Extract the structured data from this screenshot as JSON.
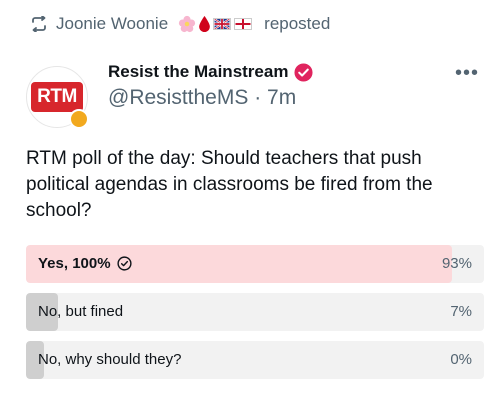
{
  "repost": {
    "user": "Joonie Woonie",
    "label": "reposted",
    "emoji_icons": [
      "cherry-blossom-icon",
      "blood-drop-icon",
      "uk-flag-icon",
      "england-flag-icon"
    ]
  },
  "author": {
    "name": "Resist the Mainstream",
    "handle": "@ResisttheMS",
    "separator": "·",
    "time": "7m",
    "avatar_text": "RTM",
    "verified": true
  },
  "post": {
    "text": "RTM poll of the day: Should teachers that push political agendas in classrooms be fired from the school?"
  },
  "poll": {
    "options": [
      {
        "label": "Yes, 100%",
        "percent_label": "93%",
        "percent": 93,
        "selected": true,
        "fill_color": "#fcd9db"
      },
      {
        "label": "No, but fined",
        "percent_label": "7%",
        "percent": 7,
        "selected": false,
        "fill_color": "#cfcfcf"
      },
      {
        "label": "No, why should they?",
        "percent_label": "0%",
        "percent": 0,
        "selected": false,
        "fill_color": "#cfcfcf"
      }
    ]
  },
  "colors": {
    "accent_red": "#d7262c",
    "muted_text": "#536471",
    "poll_track": "#f2f2f2"
  }
}
